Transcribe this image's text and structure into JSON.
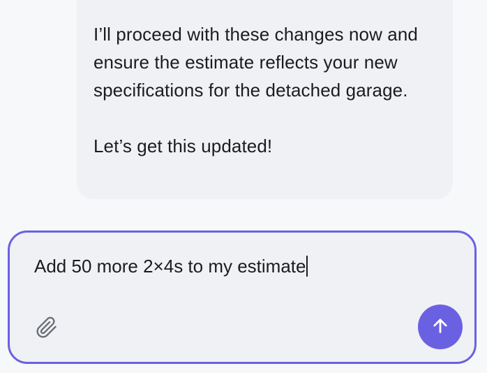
{
  "conversation": {
    "assistant_message": {
      "paragraph_1": "I’ll proceed with these changes now and ensure the estimate reflects your new specifications for the detached garage.",
      "paragraph_2": "Let’s get this updated!"
    }
  },
  "composer": {
    "input_value": "Add 50 more 2×4s to my estimate",
    "attach_icon": "paperclip-icon",
    "send_icon": "arrow-up-icon",
    "accent_color": "#6a61e2"
  }
}
